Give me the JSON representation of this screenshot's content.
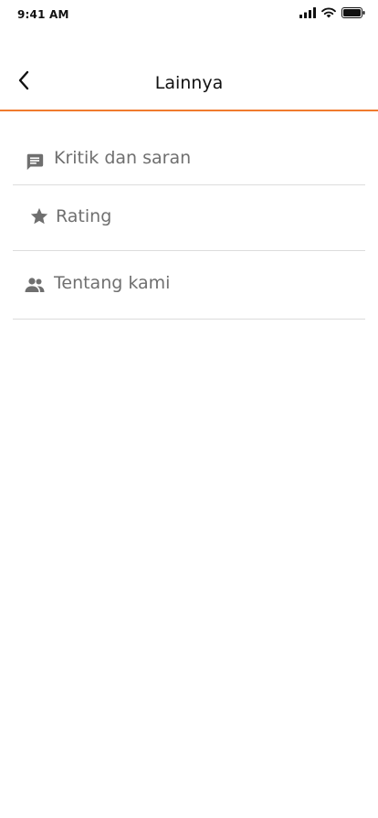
{
  "status_bar": {
    "time": "9:41 AM",
    "icons": [
      "signal-icon",
      "wifi-icon",
      "battery-icon"
    ]
  },
  "header": {
    "title": "Lainnya",
    "back_icon": "chevron-left-icon",
    "accent_color": "#f07b2e"
  },
  "menu": {
    "items": [
      {
        "label": "Kritik dan saran",
        "icon": "message-icon"
      },
      {
        "label": "Rating",
        "icon": "star-icon"
      },
      {
        "label": "Tentang kami",
        "icon": "people-icon"
      }
    ]
  }
}
